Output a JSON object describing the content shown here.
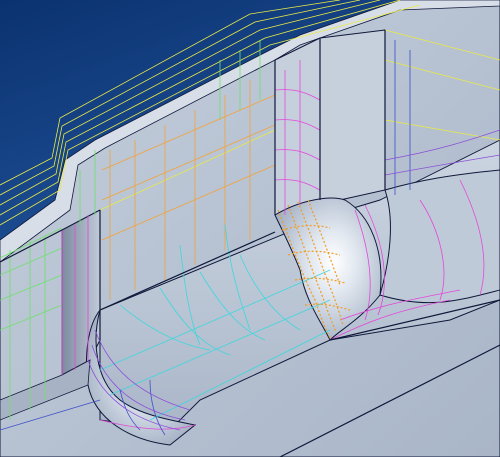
{
  "viewport": {
    "background_top_color": "#0b3270",
    "background_bottom_color": "#2d68b4"
  },
  "model": {
    "surface_color": "#b9c4d4",
    "surface_shadow_color": "#8e9bb0",
    "highlight_color": "#ffffff",
    "edge_color": "#10183a"
  },
  "isoline_colors": {
    "yellow": "#e9ea46",
    "green": "#6ee06a",
    "magenta": "#e248d8",
    "cyan": "#3fd6dc",
    "orange": "#f2a23a",
    "blue": "#3d4fc8",
    "purple": "#8a4fd8"
  },
  "selected_face": {
    "highlight_color": "#f39b1e"
  }
}
